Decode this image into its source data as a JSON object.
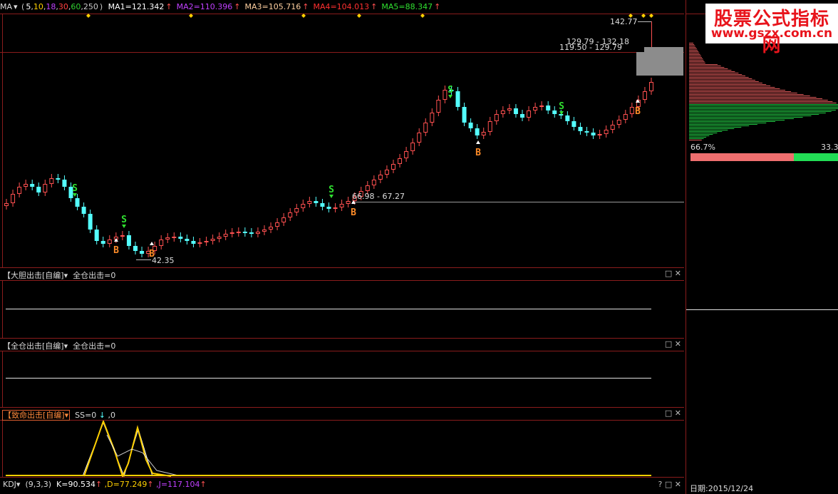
{
  "main": {
    "indicator_name": "MA",
    "params_open": "(",
    "params": [
      {
        "text": "5",
        "color": "#ffffff"
      },
      {
        "text": "10",
        "color": "#ffd000"
      },
      {
        "text": "18",
        "color": "#c040ff"
      },
      {
        "text": "30",
        "color": "#ff4040"
      },
      {
        "text": "60",
        "color": "#30d030"
      },
      {
        "text": "250",
        "color": "#c8c8c8"
      }
    ],
    "params_close": ")",
    "mas": [
      {
        "label": "MA1=121.342",
        "color": "#ffffff"
      },
      {
        "label": "MA2=110.396",
        "color": "#c040ff"
      },
      {
        "label": "MA3=105.716",
        "color": "#ffd0a0"
      },
      {
        "label": "MA4=104.013",
        "color": "#ff3030"
      },
      {
        "label": "MA5=88.347",
        "color": "#30e030"
      }
    ],
    "up_arrow": "↑",
    "price_high": "142.77",
    "zone1": "129.79 - 132.18",
    "zone2": "119.50 - 129.79",
    "zone3": "66.98 - 67.27",
    "price_low": "42.35",
    "colors": {
      "up": "#ff5050",
      "down": "#54ffff",
      "signal_s": "#30e030",
      "signal_b": "#ff8c28",
      "marker": "#ffd000"
    }
  },
  "signals": [
    {
      "type": "S",
      "label": "S"
    },
    {
      "type": "S",
      "label": "S"
    },
    {
      "type": "S",
      "label": "S"
    },
    {
      "type": "S",
      "label": "S"
    },
    {
      "type": "S",
      "label": "S"
    },
    {
      "type": "B",
      "label": "B"
    },
    {
      "type": "B",
      "label": "B"
    },
    {
      "type": "B",
      "label": "B"
    },
    {
      "type": "B",
      "label": "B"
    },
    {
      "type": "B",
      "label": "B"
    },
    {
      "type": "B",
      "label": "B"
    }
  ],
  "pane1": {
    "title": "【大胆出击[自编]▾",
    "value": "全仓出击=0"
  },
  "pane2": {
    "title": "【全仓出击[自编]▾",
    "value": "全仓出击=0"
  },
  "pane3": {
    "title": "【致命出击[自编]▾",
    "value_prefix": "SS=0",
    "value_suffix": ",0"
  },
  "kdj": {
    "name": "KDJ▾",
    "params": "(9,3,3)",
    "k": "K=90.534",
    "d": ",D=77.249",
    "j": ",J=117.104"
  },
  "pane_controls": {
    "max": "□",
    "close": "✕",
    "help": "?"
  },
  "right": {
    "logo_line1": "股票公式指标网",
    "logo_line2": "www.gszx.com.cn",
    "pct_left": "66.7%",
    "pct_right": "33.3",
    "date": "日期:2015/12/24",
    "profit_ratio": 0.667
  }
}
